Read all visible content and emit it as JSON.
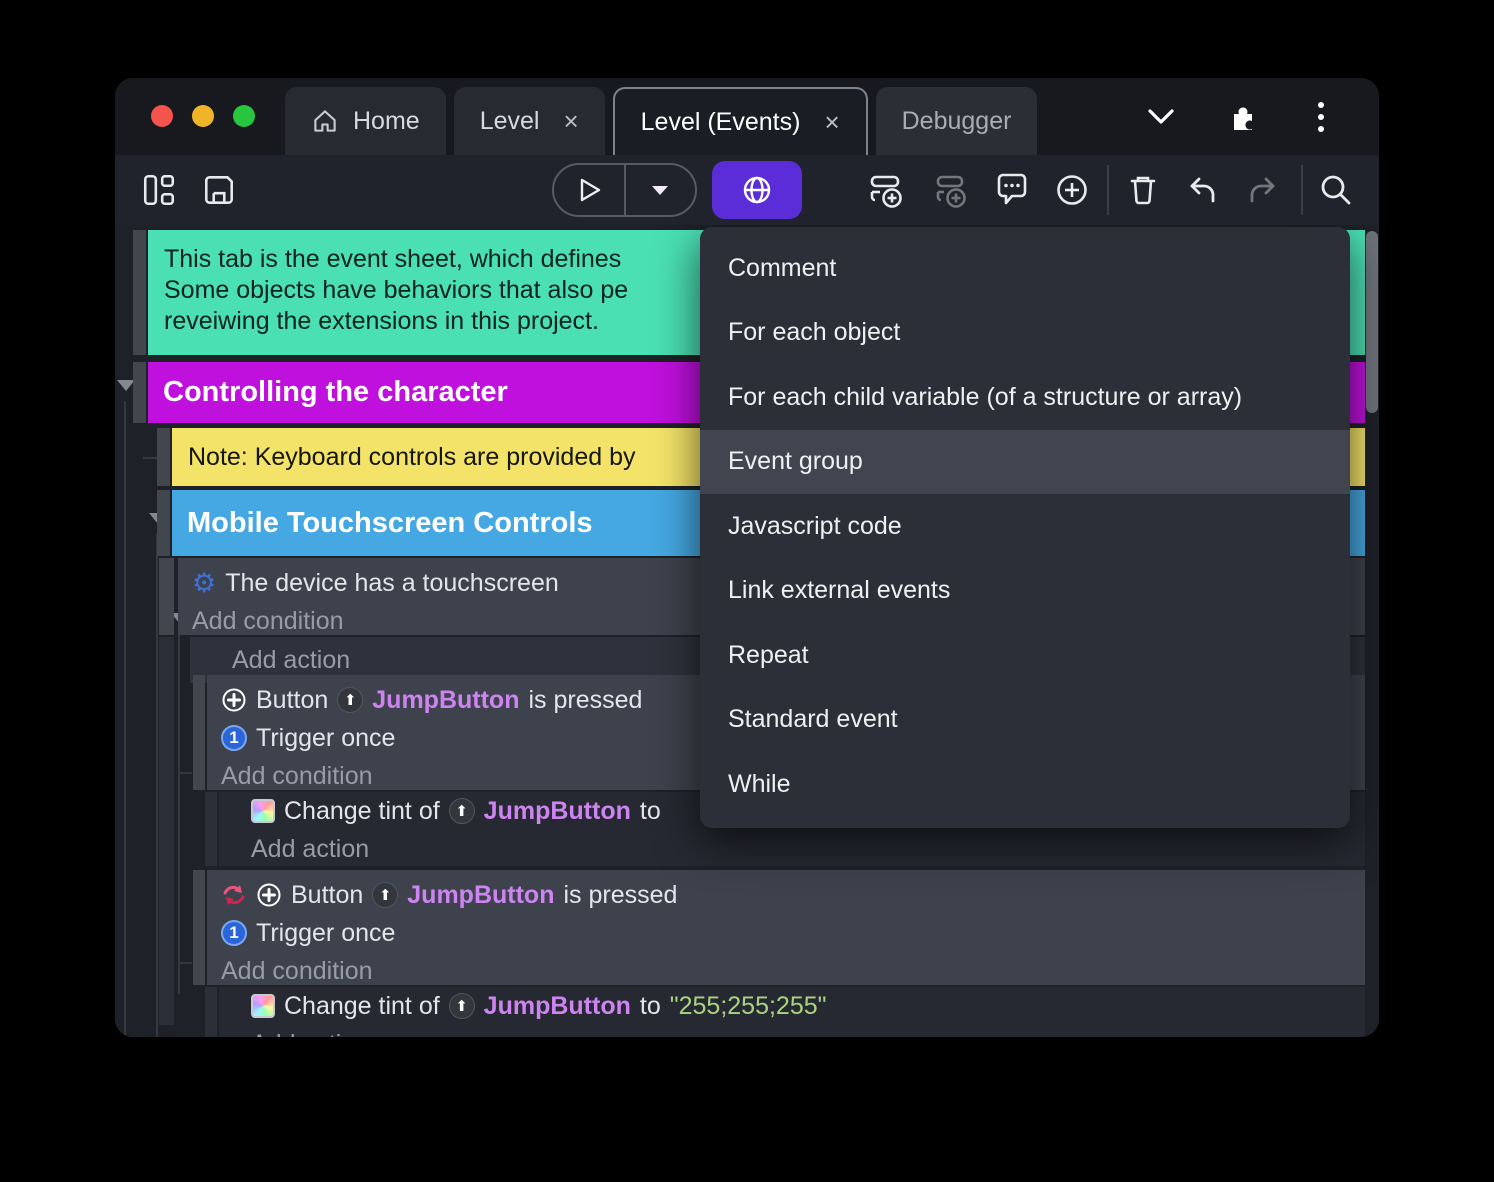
{
  "colors": {
    "accent_purple": "#5a2dd8",
    "comment_green": "#4be0b4",
    "group_magenta": "#bf10dd",
    "note_yellow": "#f3e469",
    "group_blue": "#45a8e2",
    "object_link_purple": "#cd84f1",
    "string_green": "#a9d47f",
    "menu_bg": "#2c2f38",
    "traffic_red": "#f4544c",
    "traffic_yellow": "#f0b429",
    "traffic_green": "#28c63f"
  },
  "titlebar": {
    "tabs": [
      {
        "label": "Home"
      },
      {
        "label": "Level"
      },
      {
        "label": "Level (Events)"
      },
      {
        "label": "Debugger"
      }
    ],
    "close_glyph": "×"
  },
  "context_menu": {
    "items": [
      "Comment",
      "For each object",
      "For each child variable (of a structure or array)",
      "Event group",
      "Javascript code",
      "Link external events",
      "Repeat",
      "Standard event",
      "While"
    ],
    "highlighted_item": "Event group"
  },
  "event_sheet": {
    "comment_lines": [
      "This tab is the event sheet, which defines",
      "Some objects have behaviors that also pe",
      "reveiwing the extensions in this project."
    ],
    "group_controlling": "Controlling the character",
    "note": "Note: Keyboard controls are provided by",
    "group_mobile": "Mobile Touchscreen Controls",
    "touch_condition": "The device has a touchscreen",
    "add_condition": "Add condition",
    "add_action": "Add action",
    "button_pressed": {
      "object": "Button",
      "instance": "JumpButton",
      "predicate": "is pressed"
    },
    "trigger_once": "Trigger once",
    "trigger_once_glyph": "1",
    "jump_arrow_glyph": "⬆",
    "gear_glyph": "⚙",
    "tint_action": {
      "prefix": "Change tint of",
      "instance": "JumpButton",
      "connector": "to",
      "value": "\"255;255;255\""
    }
  }
}
